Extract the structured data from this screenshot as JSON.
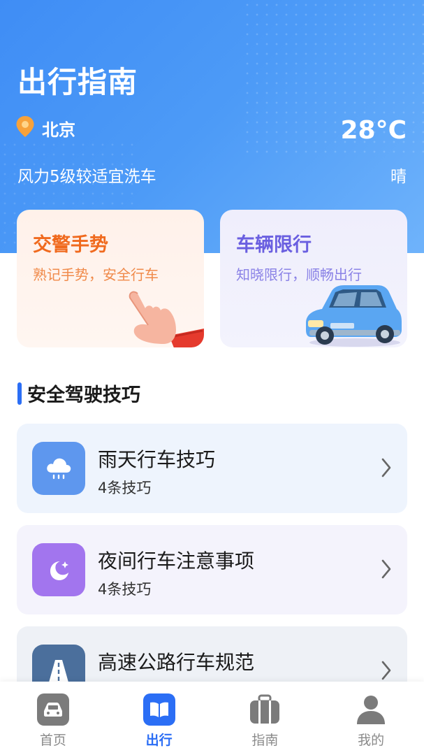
{
  "header": {
    "title": "出行指南",
    "location": "北京",
    "temperature": "28°C",
    "wind": "风力5级较适宜洗车",
    "weather": "晴"
  },
  "cards": [
    {
      "title": "交警手势",
      "subtitle": "熟记手势，安全行车",
      "illustration": "pointing-hand"
    },
    {
      "title": "车辆限行",
      "subtitle": "知晓限行，顺畅出行",
      "illustration": "blue-car"
    }
  ],
  "section": {
    "title": "安全驾驶技巧"
  },
  "tips": [
    {
      "title": "雨天行车技巧",
      "subtitle": "4条技巧",
      "icon": "rain-cloud-icon"
    },
    {
      "title": "夜间行车注意事项",
      "subtitle": "4条技巧",
      "icon": "moon-icon"
    },
    {
      "title": "高速公路行车规范",
      "subtitle": "",
      "icon": "highway-icon"
    }
  ],
  "tabbar": {
    "items": [
      {
        "label": "首页",
        "icon": "car-icon",
        "active": false
      },
      {
        "label": "出行",
        "icon": "book-icon",
        "active": true
      },
      {
        "label": "指南",
        "icon": "suitcase-icon",
        "active": false
      },
      {
        "label": "我的",
        "icon": "person-icon",
        "active": false
      }
    ]
  },
  "colors": {
    "primary": "#2b6ef5",
    "hero_blue": "#4d9bf7",
    "gesture_orange": "#f06a1e",
    "limit_purple": "#6a5fe0"
  }
}
